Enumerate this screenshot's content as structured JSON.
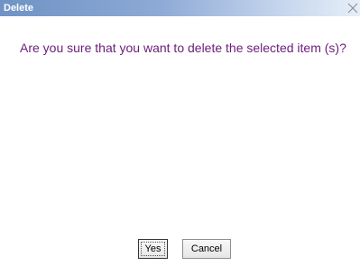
{
  "dialog": {
    "title": "Delete",
    "message": "Are you sure that you want to delete the selected item (s)?",
    "buttons": {
      "yes_label": "Yes",
      "cancel_label": "Cancel"
    },
    "close_icon": "close-x-icon"
  },
  "colors": {
    "title_bar": "#6f93c4",
    "message_text": "#6a1d7a"
  }
}
